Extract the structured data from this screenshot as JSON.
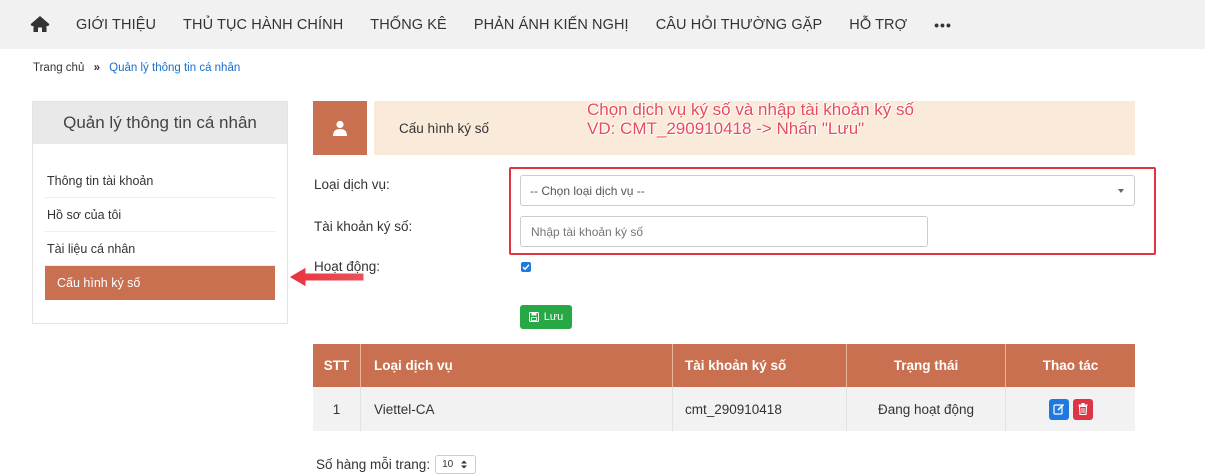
{
  "nav": {
    "items": [
      "GIỚI THIỆU",
      "THỦ TỤC HÀNH CHÍNH",
      "THỐNG KÊ",
      "PHẢN ÁNH KIẾN NGHỊ",
      "CÂU HỎI THƯỜNG GẶP",
      "HỖ TRỢ"
    ],
    "more": "•••",
    "home_icon": "home-icon"
  },
  "breadcrumb": {
    "home": "Trang chủ",
    "separator": "»",
    "current": "Quản lý thông tin cá nhân"
  },
  "sidebar": {
    "title": "Quản lý thông tin cá nhân",
    "items": [
      {
        "label": "Thông tin tài khoản"
      },
      {
        "label": "Hồ sơ của tôi"
      },
      {
        "label": "Tài liệu cá nhân"
      },
      {
        "label": "Cấu hình ký số"
      }
    ],
    "active_index": 3
  },
  "banner": {
    "title": "Cấu hình ký số",
    "annotation_line1": "Chọn dịch vụ ký số và nhập tài khoản ký số",
    "annotation_line2": "VD: CMT_290910418 -> Nhấn \"Lưu\""
  },
  "form": {
    "service_label": "Loại dịch vụ:",
    "service_placeholder": "-- Chọn loại dịch vụ --",
    "account_label": "Tài khoản ký số:",
    "account_placeholder": "Nhập tài khoản ký số",
    "active_label": "Hoạt động:",
    "active_checked": true,
    "save_label": "Lưu"
  },
  "table": {
    "headers": [
      "STT",
      "Loại dịch vụ",
      "Tài khoản ký số",
      "Trạng thái",
      "Thao tác"
    ],
    "rows": [
      {
        "stt": "1",
        "service": "Viettel-CA",
        "account": "cmt_290910418",
        "status": "Đang hoạt động"
      }
    ]
  },
  "pager": {
    "label": "Số hàng mỗi trang:",
    "page_size": "10"
  },
  "colors": {
    "accent": "#c8704f",
    "banner_bg": "#f9ead9",
    "annotation": "#e84a5f",
    "save": "#28a745",
    "edit": "#1f7ae0",
    "delete": "#dc3545"
  }
}
